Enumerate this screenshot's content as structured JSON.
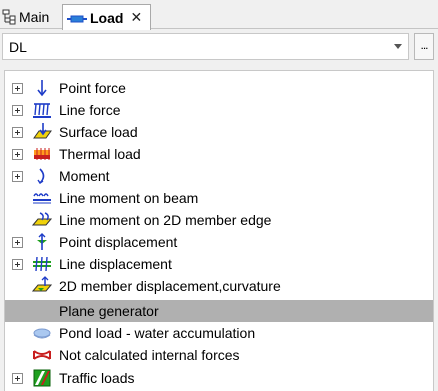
{
  "tabs": [
    {
      "label": "Main"
    },
    {
      "label": "Load"
    }
  ],
  "combo": {
    "value": "DL",
    "browse_label": "..."
  },
  "tree": {
    "items": [
      {
        "label": "Point force",
        "icon": "point-force-icon",
        "expandable": true
      },
      {
        "label": "Line force",
        "icon": "line-force-icon",
        "expandable": true
      },
      {
        "label": "Surface load",
        "icon": "surface-load-icon",
        "expandable": true
      },
      {
        "label": "Thermal load",
        "icon": "thermal-load-icon",
        "expandable": true
      },
      {
        "label": "Moment",
        "icon": "moment-icon",
        "expandable": true
      },
      {
        "label": "Line moment on beam",
        "icon": "line-moment-beam-icon",
        "expandable": false
      },
      {
        "label": "Line moment on 2D member edge",
        "icon": "line-moment-edge-icon",
        "expandable": false
      },
      {
        "label": "Point displacement",
        "icon": "point-displacement-icon",
        "expandable": true
      },
      {
        "label": "Line displacement",
        "icon": "line-displacement-icon",
        "expandable": true
      },
      {
        "label": "2D member displacement,curvature",
        "icon": "member-displacement-icon",
        "expandable": false
      },
      {
        "label": "Plane generator",
        "icon": "plane-generator-icon",
        "expandable": false,
        "selected": true
      },
      {
        "label": "Pond load - water accumulation",
        "icon": "pond-load-icon",
        "expandable": false
      },
      {
        "label": "Not calculated internal forces",
        "icon": "internal-forces-icon",
        "expandable": false
      },
      {
        "label": "Traffic loads",
        "icon": "traffic-loads-icon",
        "expandable": true
      }
    ]
  },
  "colors": {
    "selection": "#b0b0b0",
    "icon_blue": "#1e3cc8",
    "icon_yellow": "#f0d20a",
    "icon_red": "#c81e1e",
    "icon_green": "#1ea01e"
  }
}
